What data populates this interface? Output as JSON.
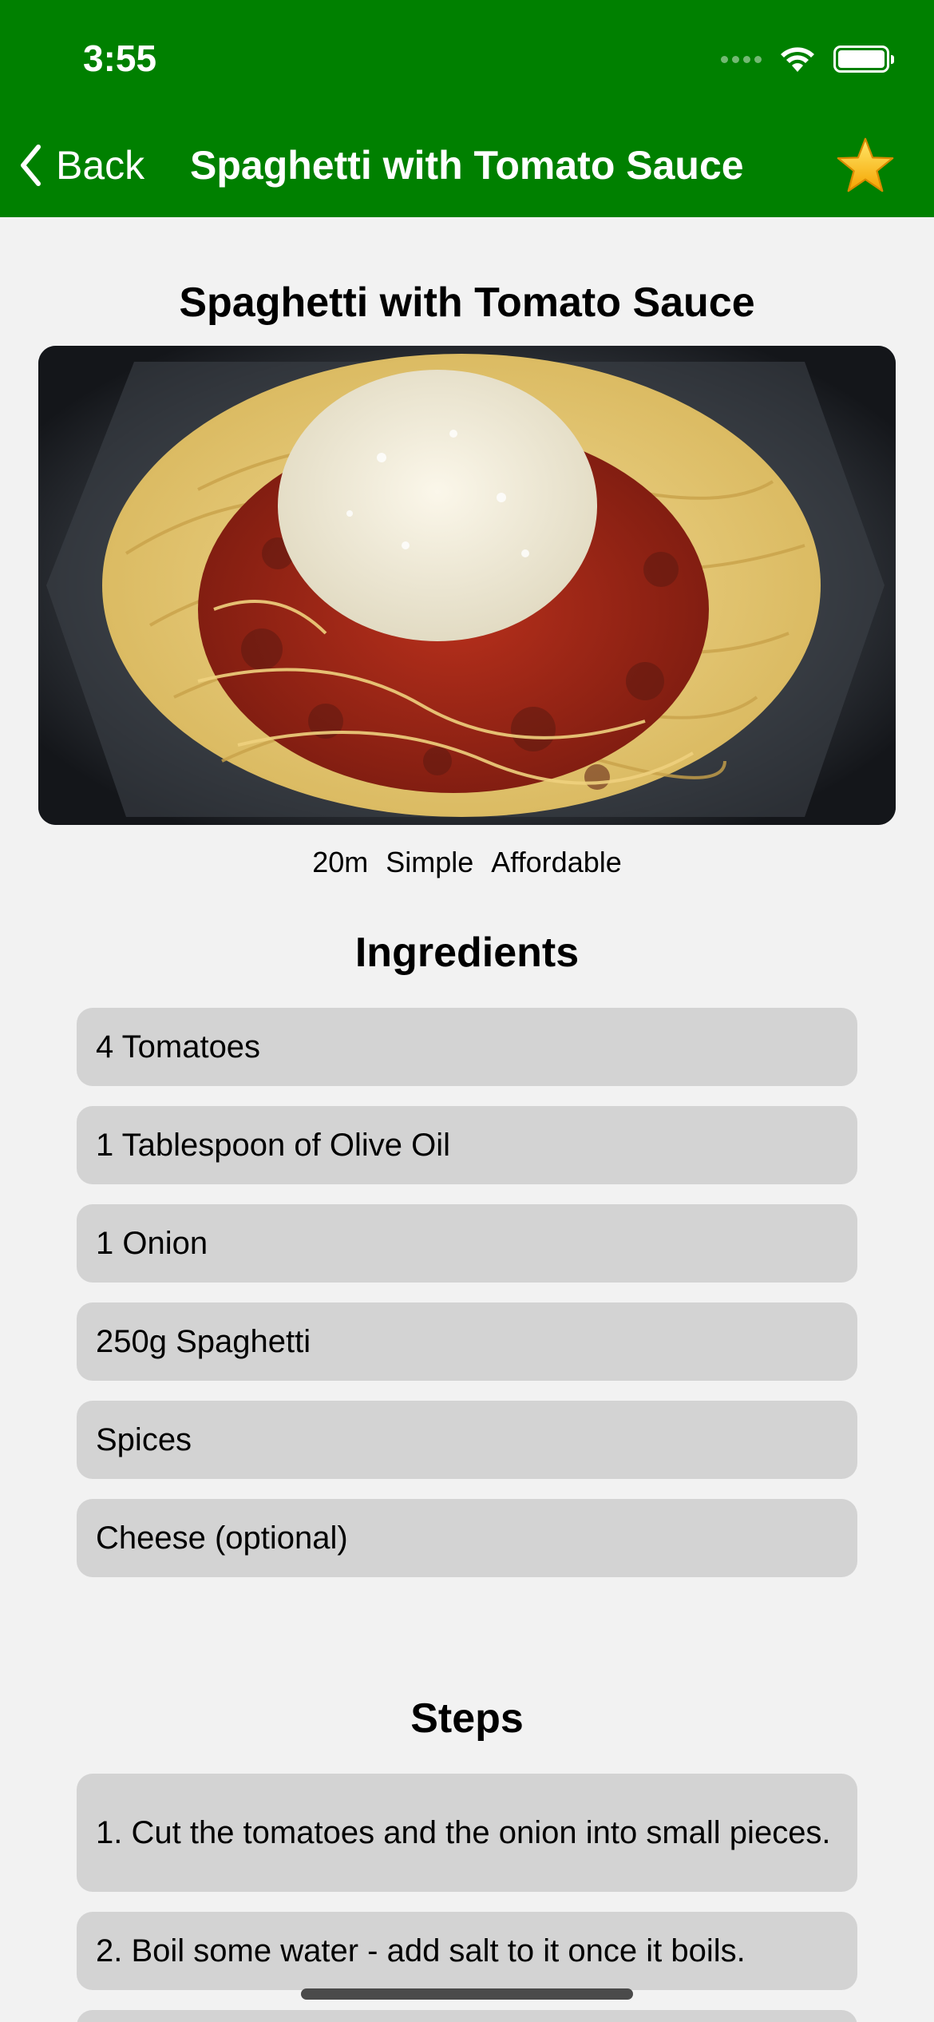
{
  "status_bar": {
    "time": "3:55"
  },
  "nav": {
    "back_label": "Back",
    "title": "Spaghetti with Tomato Sauce",
    "favorite_icon": "star-icon"
  },
  "recipe": {
    "title": "Spaghetti with Tomato Sauce",
    "duration": "20m",
    "complexity": "Simple",
    "affordability": "Affordable"
  },
  "ingredients": {
    "heading": "Ingredients",
    "items": [
      "4 Tomatoes",
      "1 Tablespoon of Olive Oil",
      "1 Onion",
      "250g Spaghetti",
      "Spices",
      "Cheese (optional)"
    ]
  },
  "steps": {
    "heading": "Steps",
    "items": [
      "1. Cut the tomatoes and the onion into small pieces.",
      "2. Boil some water - add salt to it once it boils."
    ]
  },
  "colors": {
    "header_green": "#008000",
    "background": "#f2f2f2",
    "list_item": "#d3d3d3"
  }
}
